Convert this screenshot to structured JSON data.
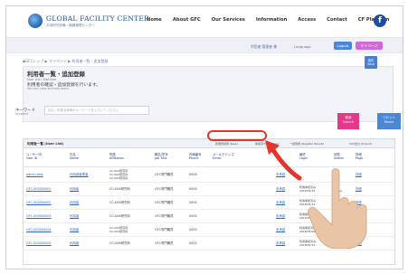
{
  "header": {
    "logo_title": "GLOBAL FACILITY CENTER",
    "logo_subtitle": "共用研究設備・機器管理センター",
    "nav": [
      "Home",
      "About GFC",
      "Our Services",
      "Information",
      "Access",
      "Contact",
      "CF Platform"
    ],
    "social_icon": "facebook-icon"
  },
  "userband": {
    "user_name": "利用者 管理者 様",
    "language": "Language",
    "logout_label": "Logout",
    "mypage_label": "マイページ"
  },
  "breadcrumb": "◆GFCトップ ▶ マイページ ▶ 利用者一覧・追加登録",
  "title": {
    "main": "利用者一覧・追加登録",
    "en": "User List / Add User",
    "desc": "利用者の確認・追加登録を行います。",
    "desc_en": "You can view and add users.",
    "save_button": "保存\nSave"
  },
  "search": {
    "keyword_label": "キーワード",
    "keyword_label_en": "Keyword",
    "placeholder": "氏名、所属名称等のキーワードを入力してください",
    "search_button": "検索\nSearch",
    "reset_button": "リセット\nReset"
  },
  "table": {
    "title": "利用者一覧 (User List)",
    "filters": [
      "新規登録者 (New)",
      "承認待ち (Waiting)",
      "一括登録 (Register Result)",
      "CSV出力 (Export)"
    ],
    "columns": [
      "ユーザーID\nUser ID",
      "氏名\nName",
      "所属\nAffiliation",
      "職名/学年\nJob Title",
      "内線番号\nPhone",
      "メールアドレス\nEmail",
      "",
      "最終\nLogin",
      "状態\nStatus",
      "詳細\nPage"
    ],
    "rows": [
      [
        "admin-test",
        "利用者管理者",
        "CC-XXX研究科\nCC-XXX研究科\nCC-XXX研究科",
        "GFC専門職員",
        "0000",
        "",
        "未承認",
        "",
        "",
        "詳細"
      ],
      [
        "GFC-000000001",
        "利用者",
        "CC-XXX研究科",
        "GFC専門職員",
        "0000",
        "",
        "未承認",
        "利用承認済み\n2018/05/15",
        "有効\nActive",
        "詳細"
      ],
      [
        "GFC-000000002",
        "利用者",
        "CC-XXX研究科",
        "GFC専門職員",
        "0000",
        "",
        "未承認",
        "利用承認済み\n2018/05/12",
        "有効\nActive",
        "詳細"
      ],
      [
        "GFC-000000003",
        "利用者",
        "CC-XXX研究科",
        "GFC専門職員",
        "0000",
        "",
        "未承認",
        "利用承認済み\n2018/05/10",
        "有効\nActive",
        "詳細"
      ],
      [
        "GFC-000000004",
        "利用者",
        "CC-XXX研究科\nCC-XXX研究科",
        "GFC専門職員",
        "0000",
        "",
        "未承認",
        "利用承認済み\n2018/05/09",
        "有効\nActive",
        "詳細"
      ],
      [
        "GFC-000000005",
        "利用者",
        "CC-XXX研究科",
        "GFC専門職員",
        "0000",
        "",
        "未承認",
        "利用承認済み\n2018/05/13",
        "有効\nActive",
        "詳細"
      ]
    ]
  },
  "colors": {
    "brand_blue": "#1f4f8f",
    "accent_pink": "#e8368a",
    "accent_blue": "#4a87d6",
    "highlight_red": "#e2352c"
  }
}
